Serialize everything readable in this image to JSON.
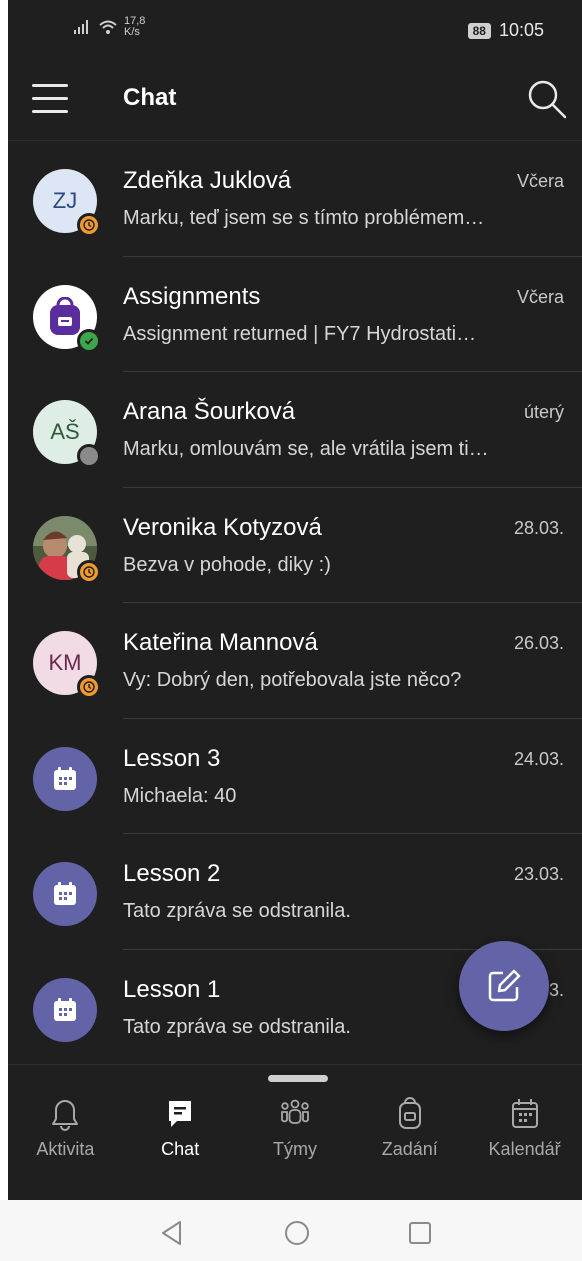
{
  "status_bar": {
    "speed": "17,8\nK/s",
    "speed_value": "17,8",
    "speed_unit": "K/s",
    "battery": "88",
    "time": "10:05"
  },
  "header": {
    "title": "Chat"
  },
  "chats": [
    {
      "initials": "ZJ",
      "name": "Zdeňka Juklová",
      "time": "Včera",
      "preview": "Marku, teď jsem se s tímto problémem…",
      "avatar_bg": "#dde6f4",
      "avatar_fg": "#2b4a7f",
      "status": "away"
    },
    {
      "initials": "",
      "name": "Assignments",
      "time": "Včera",
      "preview": "Assignment returned | FY7 Hydrostati…",
      "avatar_bg": "#ffffff",
      "avatar_fg": "#5b2c9b",
      "status": "online",
      "icon": "backpack-icon"
    },
    {
      "initials": "AŠ",
      "name": "Arana Šourková",
      "time": "úterý",
      "preview": "Marku, omlouvám se, ale vrátila jsem ti…",
      "avatar_bg": "#dfeee4",
      "avatar_fg": "#2f5a3d",
      "status": "offline"
    },
    {
      "initials": "",
      "name": "Veronika Kotyzová",
      "time": "28.03.",
      "preview": "Bezva v pohode, diky :)",
      "avatar_bg": "#8a6b5a",
      "avatar_fg": "#ffffff",
      "status": "away",
      "icon": "photo-avatar"
    },
    {
      "initials": "KM",
      "name": "Kateřina Mannová",
      "time": "26.03.",
      "preview": "Vy: Dobrý den, potřebovala jste něco?",
      "avatar_bg": "#f1dce6",
      "avatar_fg": "#6b2a4d",
      "status": "away"
    },
    {
      "initials": "",
      "name": "Lesson 3",
      "time": "24.03.",
      "preview": "Michaela: 40",
      "avatar_bg": "#6264a7",
      "avatar_fg": "#ffffff",
      "icon": "calendar-icon"
    },
    {
      "initials": "",
      "name": "Lesson 2",
      "time": "23.03.",
      "preview": "Tato zpráva se odstranila.",
      "avatar_bg": "#6264a7",
      "avatar_fg": "#ffffff",
      "icon": "calendar-icon"
    },
    {
      "initials": "",
      "name": "Lesson 1",
      "time": "23.03.",
      "preview": "Tato zpráva se odstranila.",
      "avatar_bg": "#6264a7",
      "avatar_fg": "#ffffff",
      "icon": "calendar-icon"
    }
  ],
  "fab": {
    "icon": "compose-icon"
  },
  "nav": [
    {
      "label": "Aktivita",
      "icon": "bell-icon"
    },
    {
      "label": "Chat",
      "icon": "chat-icon",
      "active": true
    },
    {
      "label": "Týmy",
      "icon": "teams-icon"
    },
    {
      "label": "Zadání",
      "icon": "backpack-icon"
    },
    {
      "label": "Kalendář",
      "icon": "calendar-icon"
    }
  ],
  "colors": {
    "accent": "#6264a7",
    "background": "#1f1f1f",
    "away": "#f29a32",
    "online": "#3ea64a"
  }
}
